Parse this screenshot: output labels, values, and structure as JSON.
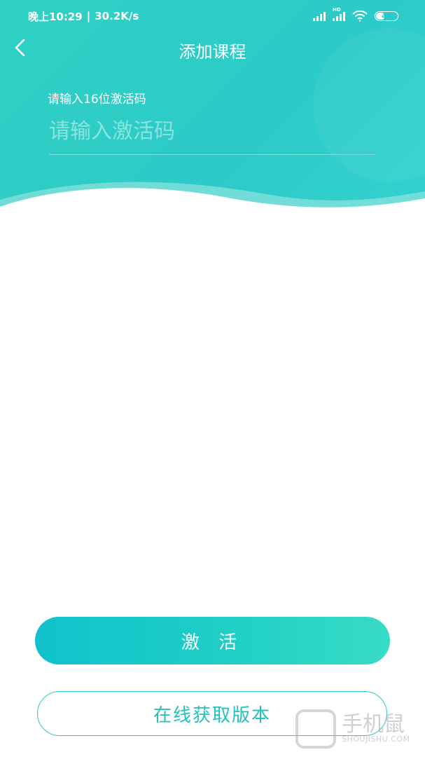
{
  "status_bar": {
    "time": "晚上10:29",
    "network_speed": "30.2K/s",
    "separator": "|",
    "signal_label": "HD",
    "battery": "44",
    "battery_level": 0.44
  },
  "nav": {
    "title": "添加课程",
    "back_icon": "chevron-left-icon"
  },
  "form": {
    "code_label": "请输入16位激活码",
    "code_placeholder": "请输入激活码",
    "code_value": ""
  },
  "actions": {
    "activate_label": "激 活",
    "online_label": "在线获取版本"
  },
  "watermark": {
    "title": "手机鼠",
    "subtitle": "SHOUJISHU.COM"
  },
  "colors": {
    "accent": "#2ccac8",
    "accent_dark": "#10c2cc",
    "accent_light": "#38dcc6"
  }
}
